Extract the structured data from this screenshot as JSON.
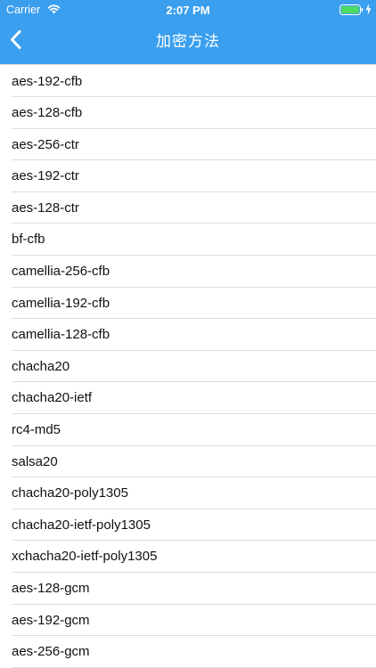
{
  "status_bar": {
    "carrier": "Carrier",
    "time": "2:07 PM",
    "wifi_icon": "wifi-icon",
    "battery_icon": "battery-icon",
    "charging_icon": "charging-icon",
    "battery_color": "#4cd964"
  },
  "nav": {
    "title": "加密方法",
    "back_icon": "chevron-left-icon",
    "bar_color": "#3a9fef"
  },
  "methods": [
    "aes-192-cfb",
    "aes-128-cfb",
    "aes-256-ctr",
    "aes-192-ctr",
    "aes-128-ctr",
    "bf-cfb",
    "camellia-256-cfb",
    "camellia-192-cfb",
    "camellia-128-cfb",
    "chacha20",
    "chacha20-ietf",
    "rc4-md5",
    "salsa20",
    "chacha20-poly1305",
    "chacha20-ietf-poly1305",
    "xchacha20-ietf-poly1305",
    "aes-128-gcm",
    "aes-192-gcm",
    "aes-256-gcm"
  ]
}
